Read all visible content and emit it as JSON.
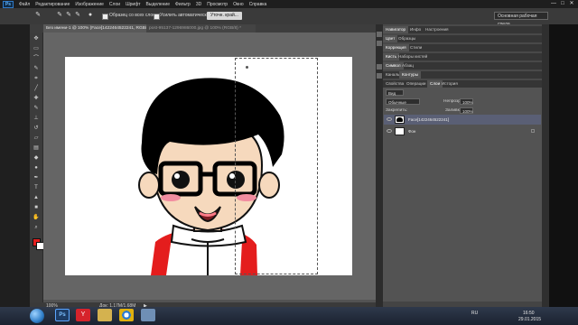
{
  "app": {
    "logo": "Ps",
    "menus": [
      "Файл",
      "Редактирование",
      "Изображение",
      "Слои",
      "Шрифт",
      "Выделение",
      "Фильтр",
      "3D",
      "Просмотр",
      "Окно",
      "Справка"
    ],
    "window_controls": [
      "—",
      "□",
      "✕"
    ]
  },
  "options": {
    "all_layers_label": "Образец со всех слоев",
    "auto_enhance_label": "Усилить автоматически",
    "refine_button": "Уточн. край...",
    "workspace": "Основная рабочая среда"
  },
  "tabs": [
    {
      "label": "Без имени-1 @ 100% (Face[1422464522241, RGB/8) *",
      "active": true
    },
    {
      "label": "post-95137-1296986000.jpg @ 100% (RGB/8) *",
      "active": false
    }
  ],
  "tools": [
    "move",
    "marquee",
    "lasso",
    "quick-select",
    "crop",
    "eyedropper",
    "spot-heal",
    "brush",
    "stamp",
    "history-brush",
    "eraser",
    "gradient",
    "blur",
    "dodge",
    "pen",
    "type",
    "path-select",
    "shape",
    "hand",
    "zoom"
  ],
  "colors": {
    "foreground": "#e41d1d",
    "background": "#ffffff"
  },
  "status": {
    "zoom": "100%",
    "doc_size": "Док: 1,17M/1,68M",
    "arrow": "▶"
  },
  "panels": {
    "top_tabs": [
      "Навигатор",
      "Инфо",
      "Настроения"
    ],
    "color_tabs": [
      "Цвет",
      "Образцы"
    ],
    "correction_tabs": [
      "Коррекция",
      "Стили"
    ],
    "brush_tabs": [
      "Кисть",
      "Наборы кистей"
    ],
    "symbol_tabs": [
      "Символ",
      "Абзац"
    ],
    "layer_tabs": [
      "Каналы",
      "Контуры"
    ],
    "props_tabs": [
      "Свойства",
      "Операции",
      "Слои",
      "История"
    ],
    "layers": {
      "kind_label": "Вид",
      "blend_mode": "Обычные",
      "opacity_label": "Непрозр.:",
      "opacity": "100%",
      "lock_label": "Закрепить:",
      "fill_label": "Заливка:",
      "fill": "100%",
      "items": [
        {
          "name": "Face[1422464522241]",
          "selected": true
        },
        {
          "name": "Фон",
          "selected": false
        }
      ]
    }
  },
  "taskbar": {
    "apps": [
      "Ps",
      "Y",
      "folder",
      "chrome",
      "explorer"
    ],
    "lang": "RU",
    "time": "16:50",
    "date": "29.01.2015"
  }
}
